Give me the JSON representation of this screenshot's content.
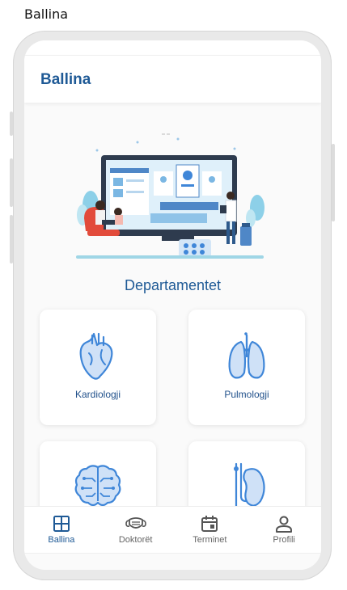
{
  "frame_title": "Ballina",
  "app_bar": {
    "title": "Ballina"
  },
  "section": {
    "title": "Departamentet"
  },
  "departments": [
    {
      "label": "Kardiologji",
      "icon": "heart-icon"
    },
    {
      "label": "Pulmologji",
      "icon": "lungs-icon"
    },
    {
      "label": "",
      "icon": "brain-icon"
    },
    {
      "label": "",
      "icon": "kidney-icon"
    }
  ],
  "nav": [
    {
      "label": "Ballina",
      "icon": "grid-icon",
      "active": true
    },
    {
      "label": "Doktorët",
      "icon": "mask-icon",
      "active": false
    },
    {
      "label": "Terminet",
      "icon": "calendar-icon",
      "active": false
    },
    {
      "label": "Profili",
      "icon": "person-icon",
      "active": false
    }
  ],
  "colors": {
    "accent": "#1f5a96",
    "icon_blue": "#3f86d8",
    "icon_fill": "#cfe1f7"
  }
}
